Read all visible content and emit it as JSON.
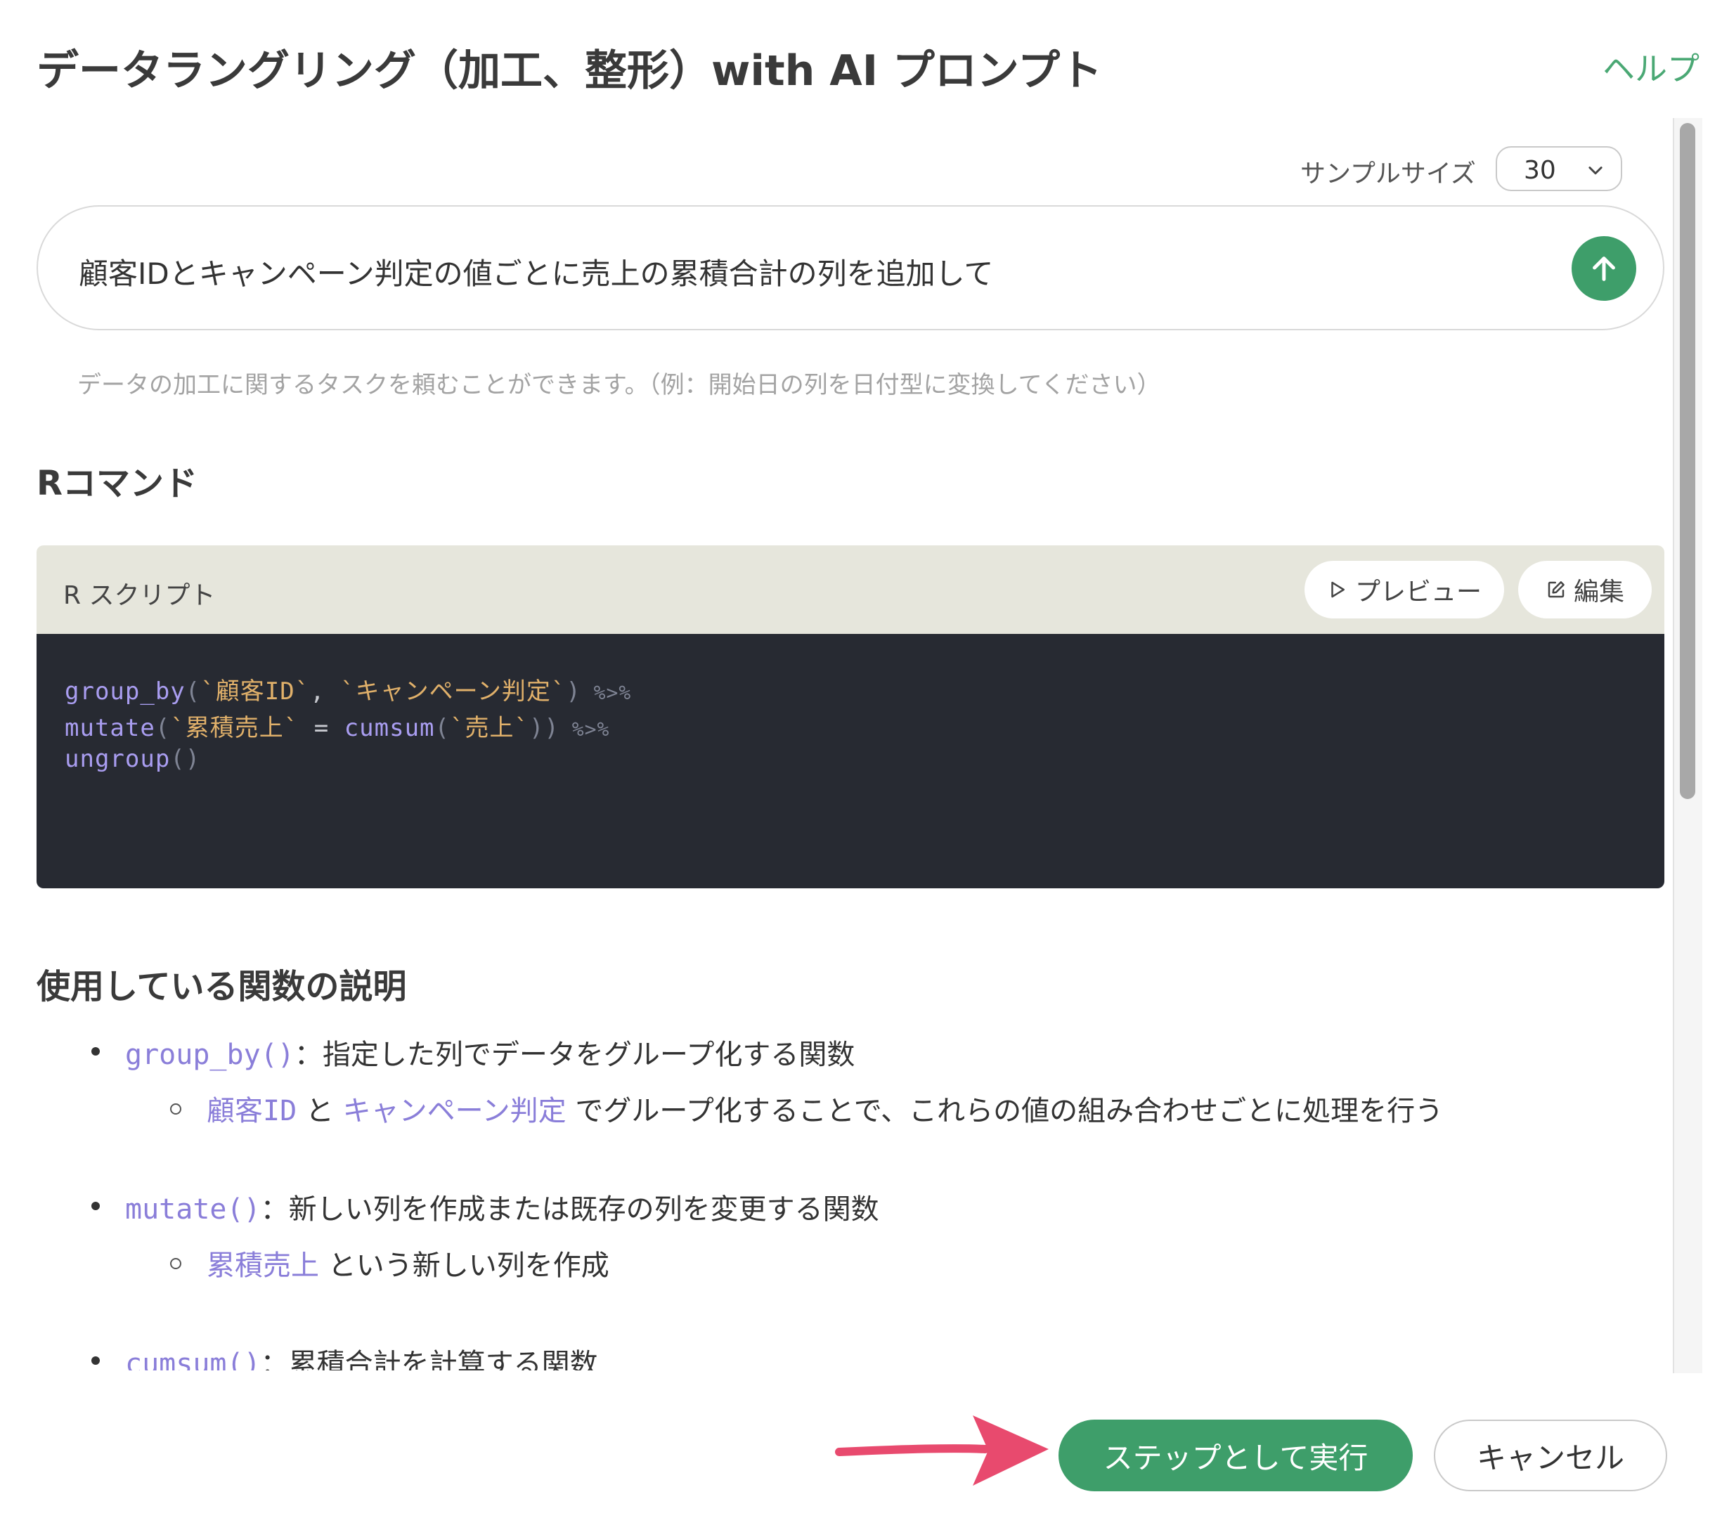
{
  "header": {
    "title": "データラングリング（加工、整形）with AI プロンプト",
    "help_label": "ヘルプ"
  },
  "sample": {
    "label": "サンプルサイズ",
    "value": "30"
  },
  "prompt": {
    "text": "顧客IDとキャンペーン判定の値ごとに売上の累積合計の列を追加して",
    "hint": "データの加工に関するタスクを頼むことができます。（例：開始日の列を日付型に変換してください）",
    "send_icon": "arrow-up-icon"
  },
  "r_command": {
    "heading": "Rコマンド",
    "panel_label": "R スクリプト",
    "preview_label": "プレビュー",
    "edit_label": "編集",
    "code": {
      "line1": {
        "fn": "group_by",
        "open": "(",
        "arg1": "`顧客ID`",
        "comma": ", ",
        "arg2": "`キャンペーン判定`",
        "close": ")",
        "pipe": " %>%"
      },
      "line2": {
        "fn": "mutate",
        "open": "(",
        "arg1": "`累積売上`",
        "eq": " = ",
        "fn2": "cumsum",
        "open2": "(",
        "arg2": "`売上`",
        "close": "))",
        "pipe": " %>%"
      },
      "line3": {
        "fn": "ungroup",
        "parens": "()"
      }
    }
  },
  "functions": {
    "heading": "使用している関数の説明",
    "items": [
      {
        "code": "group_by()",
        "desc": "：指定した列でデータをグループ化する関数",
        "sub": {
          "hl1": "顧客ID",
          "t1": " と ",
          "hl2": "キャンペーン判定",
          "t2": " でグループ化することで、これらの値の組み合わせごとに処理を行う"
        }
      },
      {
        "code": "mutate()",
        "desc": "：新しい列を作成または既存の列を変更する関数",
        "sub": {
          "hl1": "累積売上",
          "t1": " という新しい列を作成"
        }
      },
      {
        "code": "cumsum()",
        "desc": "：累積合計を計算する関数"
      }
    ]
  },
  "footer": {
    "run_label": "ステップとして実行",
    "cancel_label": "キャンセル"
  },
  "colors": {
    "accent": "#3e9e6a",
    "arrow": "#e84a6e",
    "code_bg": "#272a32",
    "code_header_bg": "#e6e6dc"
  }
}
